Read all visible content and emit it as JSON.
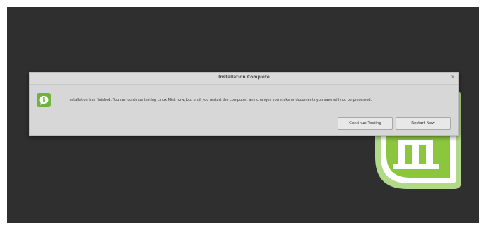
{
  "dialog": {
    "title": "Installation Complete",
    "close_symbol": "×",
    "message": "Installation has finished.  You can continue testing Linux Mint now, but until you restart the computer, any changes you make or documents you save will not be preserved.",
    "buttons": {
      "continue_label": "Continue Testing",
      "restart_label": "Restart Now"
    },
    "icon": "info-icon"
  },
  "background": {
    "logo": "linux-mint-logo",
    "color": "#2f2f2f"
  },
  "colors": {
    "mint_green": "#8cc63f",
    "dialog_bg": "#d7d7d7"
  }
}
